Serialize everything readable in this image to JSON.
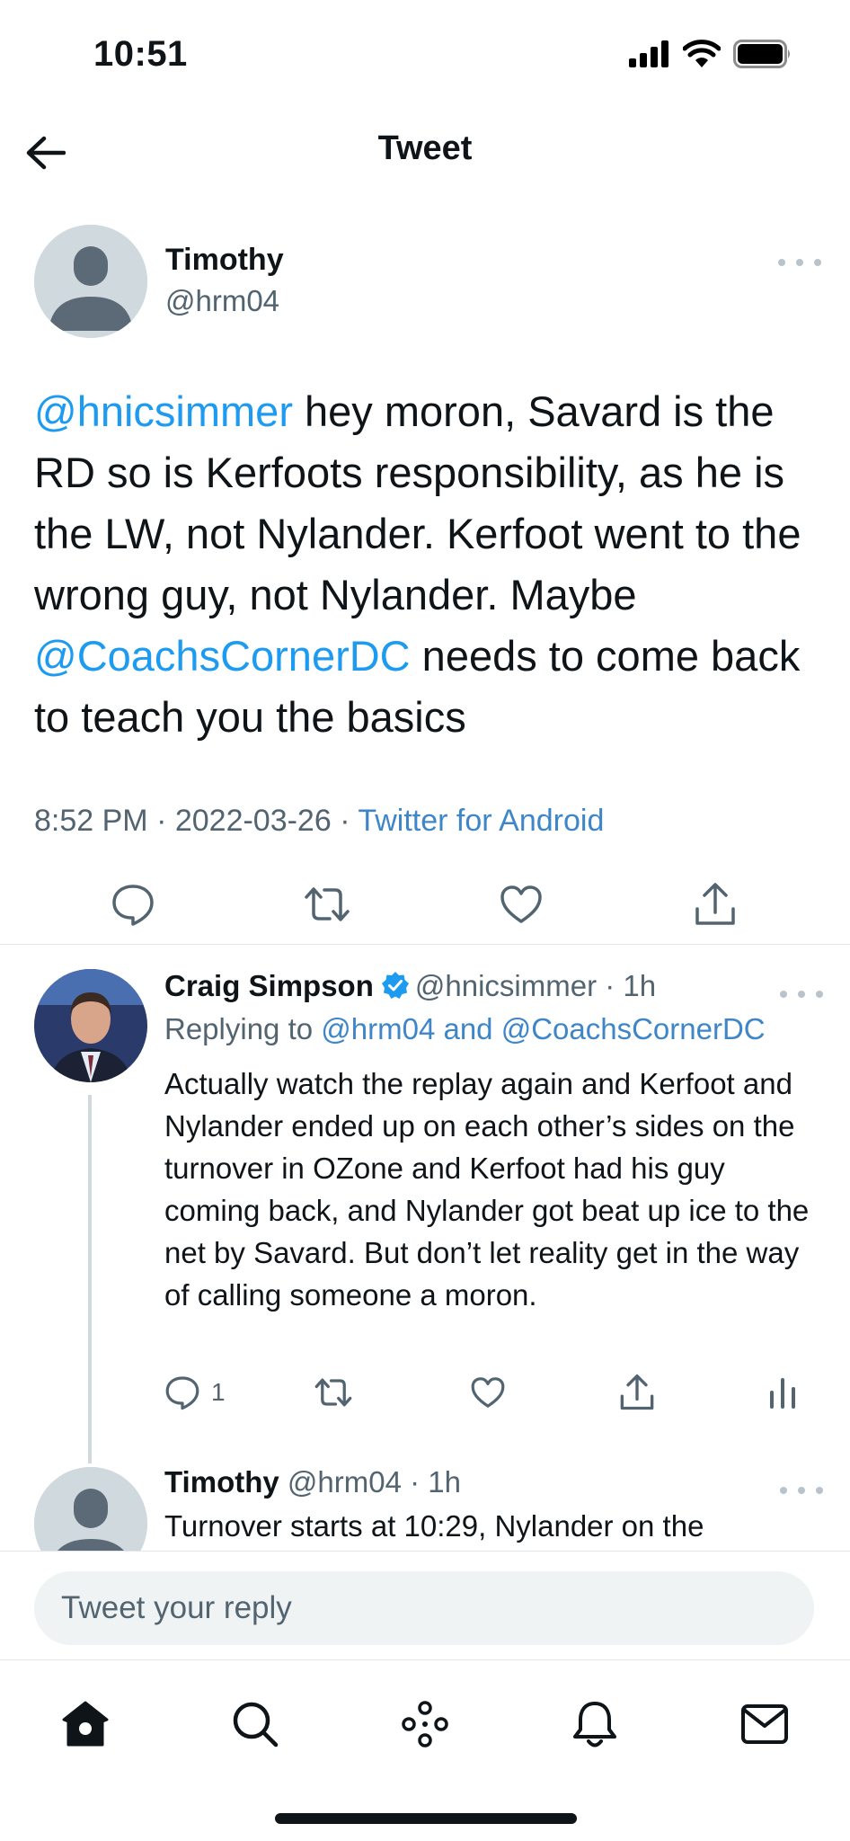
{
  "status_bar": {
    "time": "10:51"
  },
  "header": {
    "title": "Tweet"
  },
  "main_tweet": {
    "author_name": "Timothy",
    "author_handle": "@hrm04",
    "text_segments": [
      {
        "text": "@hnicsimmer",
        "type": "mention"
      },
      {
        "text": " hey moron, Savard is the RD so is Kerfoots responsibility, as he is the LW, not Nylander. Kerfoot went to the wrong guy, not Nylander. Maybe ",
        "type": "text"
      },
      {
        "text": "@CoachsCornerDC",
        "type": "mention"
      },
      {
        "text": " needs to come back to teach you the basics",
        "type": "text"
      }
    ],
    "timestamp": "8:52 PM · 2022-03-26 · ",
    "source": "Twitter for Android"
  },
  "replies": [
    {
      "author_name": "Craig Simpson",
      "verified": true,
      "author_handle": "@hnicsimmer · 1h",
      "replying_prefix": "Replying to ",
      "replying_to": "@hrm04 and @CoachsCornerDC",
      "text": "Actually watch the replay again and Kerfoot and Nylander ended up on each other’s sides on the turnover in OZone and Kerfoot had his guy coming back, and Nylander got beat up ice to the net by Savard. But don’t let reality get in the way of calling someone a moron.",
      "reply_count": "1"
    },
    {
      "author_name": "Timothy",
      "author_handle": "@hrm04 · 1h",
      "text": "Turnover starts at 10:29, Nylander on the"
    }
  ],
  "compose": {
    "placeholder": "Tweet your reply"
  },
  "colors": {
    "accent": "#1d9bf0",
    "link": "#3e86c8",
    "text": "#0f1419",
    "muted": "#536471"
  },
  "icons": [
    "back-arrow-icon",
    "more-icon",
    "reply-icon",
    "retweet-icon",
    "like-icon",
    "share-icon",
    "analytics-icon",
    "verified-icon",
    "home-icon",
    "search-icon",
    "spaces-icon",
    "notifications-icon",
    "messages-icon"
  ]
}
